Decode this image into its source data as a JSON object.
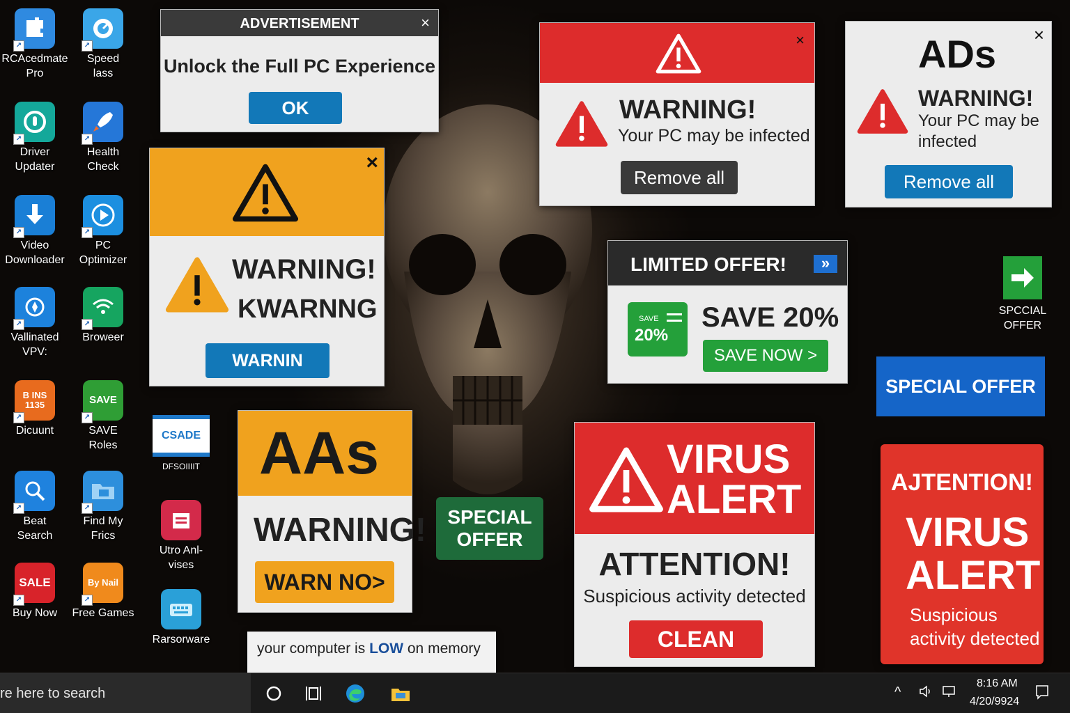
{
  "desktop_icons": [
    {
      "label": "RCAcedmate\nPro",
      "color": "#2f8ae0",
      "icon": "puzzle-icon"
    },
    {
      "label": "Speed\nlass",
      "color": "#3aa6e8",
      "icon": "speedometer-icon"
    },
    {
      "label": "Driver\nUpdater",
      "color": "#14a89a",
      "icon": "gauge-icon"
    },
    {
      "label": "Health\nCheck",
      "color": "#2577d8",
      "icon": "rocket-icon"
    },
    {
      "label": "Video\nDownloader",
      "color": "#1a7fd6",
      "icon": "download-arrow-icon"
    },
    {
      "label": "PC\nOptimizer",
      "color": "#1c8fe0",
      "icon": "play-circle-icon"
    },
    {
      "label": "Vallinated\nVPV:",
      "color": "#1d82dc",
      "icon": "shield-icon"
    },
    {
      "label": "Broweer",
      "color": "#16a560",
      "icon": "wifi-icon"
    },
    {
      "label": "Dicuunt",
      "color": "#e86b1e",
      "icon": "sale-tag-icon"
    },
    {
      "label": "SAVE\nRoles",
      "color": "#2f9e35",
      "icon": "save-tag-icon"
    },
    {
      "label": "Beat\nSearch",
      "color": "#1f82de",
      "icon": "magnifier-icon"
    },
    {
      "label": "Find My\nFrics",
      "color": "#2d8fdc",
      "icon": "folder-icon"
    },
    {
      "label": "Buy Now",
      "color": "#d8232a",
      "icon": "sale-icon"
    },
    {
      "label": "Free Games",
      "color": "#f08a1c",
      "icon": "games-icon"
    }
  ],
  "desktop_icon_texts": {
    "sale": "SALE",
    "bynail": "By Nail",
    "save": "SAVE",
    "b135": "B INS\n1135"
  },
  "mid_icons": [
    {
      "label": "DFSOIIIIT",
      "badge": "CSADE"
    },
    {
      "label": "Utro Anl-\nvises"
    },
    {
      "label": "Rarsorware"
    }
  ],
  "ad_popup": {
    "header": "ADVERTISEMENT",
    "message": "Unlock the Full PC Experience",
    "button": "OK",
    "close": "×"
  },
  "orange_warning": {
    "title": "WARNING!",
    "subtitle": "KWARNNG",
    "button": "WARNIN",
    "close": "×"
  },
  "red_warning": {
    "title": "WARNING!",
    "message": "Your PC may be infected",
    "button": "Remove all",
    "close": "×"
  },
  "ads_warning": {
    "header": "ADs",
    "title": "WARNING!",
    "message": "Your PC may be\ninfected",
    "button": "Remove all",
    "close": "×"
  },
  "limited_offer": {
    "header": "LIMITED OFFER!",
    "badge_small": "SAVE",
    "badge_big": "20%",
    "headline": "SAVE 20%",
    "button": "SAVE NOW >"
  },
  "special_offer_icon": {
    "label": "SPCCIAL\nOFFER"
  },
  "special_offer_blue": {
    "text": "SPECIAL OFFER"
  },
  "aas_warning": {
    "header": "AAs",
    "title": "WARNING!",
    "button": "WARN NO>"
  },
  "special_offer_green": {
    "text": "SPECIAL\nOFFER"
  },
  "virus_alert": {
    "header": "VIRUS\nALERT",
    "title": "ATTENTION!",
    "message": "Suspicious activity detected",
    "button": "CLEAN"
  },
  "attention_alert": {
    "title": "AJTENTION!",
    "headline": "VIRUS\nALERT",
    "message": "Suspicious\nactivity detected"
  },
  "memory_notice": {
    "prefix": "your computer is ",
    "highlight": "LOW",
    "suffix": " on memory"
  },
  "taskbar": {
    "search_text": "re here to search",
    "time": "8:16 AM",
    "date": "4/20/9924"
  },
  "colors": {
    "warning_orange": "#f0a21e",
    "alert_red": "#dd2c2c",
    "button_blue": "#1278b8",
    "offer_green": "#24a03a",
    "offer_blue": "#1565c8",
    "dark_green": "#1e6b3a"
  }
}
